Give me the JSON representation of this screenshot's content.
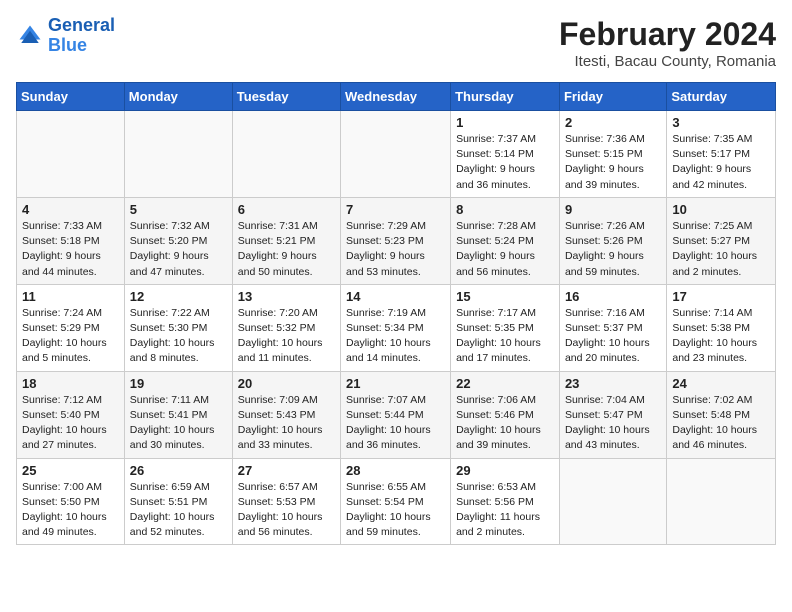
{
  "header": {
    "logo_line1": "General",
    "logo_line2": "Blue",
    "month_year": "February 2024",
    "location": "Itesti, Bacau County, Romania"
  },
  "days_of_week": [
    "Sunday",
    "Monday",
    "Tuesday",
    "Wednesday",
    "Thursday",
    "Friday",
    "Saturday"
  ],
  "weeks": [
    [
      {
        "day": "",
        "content": ""
      },
      {
        "day": "",
        "content": ""
      },
      {
        "day": "",
        "content": ""
      },
      {
        "day": "",
        "content": ""
      },
      {
        "day": "1",
        "content": "Sunrise: 7:37 AM\nSunset: 5:14 PM\nDaylight: 9 hours and 36 minutes."
      },
      {
        "day": "2",
        "content": "Sunrise: 7:36 AM\nSunset: 5:15 PM\nDaylight: 9 hours and 39 minutes."
      },
      {
        "day": "3",
        "content": "Sunrise: 7:35 AM\nSunset: 5:17 PM\nDaylight: 9 hours and 42 minutes."
      }
    ],
    [
      {
        "day": "4",
        "content": "Sunrise: 7:33 AM\nSunset: 5:18 PM\nDaylight: 9 hours and 44 minutes."
      },
      {
        "day": "5",
        "content": "Sunrise: 7:32 AM\nSunset: 5:20 PM\nDaylight: 9 hours and 47 minutes."
      },
      {
        "day": "6",
        "content": "Sunrise: 7:31 AM\nSunset: 5:21 PM\nDaylight: 9 hours and 50 minutes."
      },
      {
        "day": "7",
        "content": "Sunrise: 7:29 AM\nSunset: 5:23 PM\nDaylight: 9 hours and 53 minutes."
      },
      {
        "day": "8",
        "content": "Sunrise: 7:28 AM\nSunset: 5:24 PM\nDaylight: 9 hours and 56 minutes."
      },
      {
        "day": "9",
        "content": "Sunrise: 7:26 AM\nSunset: 5:26 PM\nDaylight: 9 hours and 59 minutes."
      },
      {
        "day": "10",
        "content": "Sunrise: 7:25 AM\nSunset: 5:27 PM\nDaylight: 10 hours and 2 minutes."
      }
    ],
    [
      {
        "day": "11",
        "content": "Sunrise: 7:24 AM\nSunset: 5:29 PM\nDaylight: 10 hours and 5 minutes."
      },
      {
        "day": "12",
        "content": "Sunrise: 7:22 AM\nSunset: 5:30 PM\nDaylight: 10 hours and 8 minutes."
      },
      {
        "day": "13",
        "content": "Sunrise: 7:20 AM\nSunset: 5:32 PM\nDaylight: 10 hours and 11 minutes."
      },
      {
        "day": "14",
        "content": "Sunrise: 7:19 AM\nSunset: 5:34 PM\nDaylight: 10 hours and 14 minutes."
      },
      {
        "day": "15",
        "content": "Sunrise: 7:17 AM\nSunset: 5:35 PM\nDaylight: 10 hours and 17 minutes."
      },
      {
        "day": "16",
        "content": "Sunrise: 7:16 AM\nSunset: 5:37 PM\nDaylight: 10 hours and 20 minutes."
      },
      {
        "day": "17",
        "content": "Sunrise: 7:14 AM\nSunset: 5:38 PM\nDaylight: 10 hours and 23 minutes."
      }
    ],
    [
      {
        "day": "18",
        "content": "Sunrise: 7:12 AM\nSunset: 5:40 PM\nDaylight: 10 hours and 27 minutes."
      },
      {
        "day": "19",
        "content": "Sunrise: 7:11 AM\nSunset: 5:41 PM\nDaylight: 10 hours and 30 minutes."
      },
      {
        "day": "20",
        "content": "Sunrise: 7:09 AM\nSunset: 5:43 PM\nDaylight: 10 hours and 33 minutes."
      },
      {
        "day": "21",
        "content": "Sunrise: 7:07 AM\nSunset: 5:44 PM\nDaylight: 10 hours and 36 minutes."
      },
      {
        "day": "22",
        "content": "Sunrise: 7:06 AM\nSunset: 5:46 PM\nDaylight: 10 hours and 39 minutes."
      },
      {
        "day": "23",
        "content": "Sunrise: 7:04 AM\nSunset: 5:47 PM\nDaylight: 10 hours and 43 minutes."
      },
      {
        "day": "24",
        "content": "Sunrise: 7:02 AM\nSunset: 5:48 PM\nDaylight: 10 hours and 46 minutes."
      }
    ],
    [
      {
        "day": "25",
        "content": "Sunrise: 7:00 AM\nSunset: 5:50 PM\nDaylight: 10 hours and 49 minutes."
      },
      {
        "day": "26",
        "content": "Sunrise: 6:59 AM\nSunset: 5:51 PM\nDaylight: 10 hours and 52 minutes."
      },
      {
        "day": "27",
        "content": "Sunrise: 6:57 AM\nSunset: 5:53 PM\nDaylight: 10 hours and 56 minutes."
      },
      {
        "day": "28",
        "content": "Sunrise: 6:55 AM\nSunset: 5:54 PM\nDaylight: 10 hours and 59 minutes."
      },
      {
        "day": "29",
        "content": "Sunrise: 6:53 AM\nSunset: 5:56 PM\nDaylight: 11 hours and 2 minutes."
      },
      {
        "day": "",
        "content": ""
      },
      {
        "day": "",
        "content": ""
      }
    ]
  ]
}
